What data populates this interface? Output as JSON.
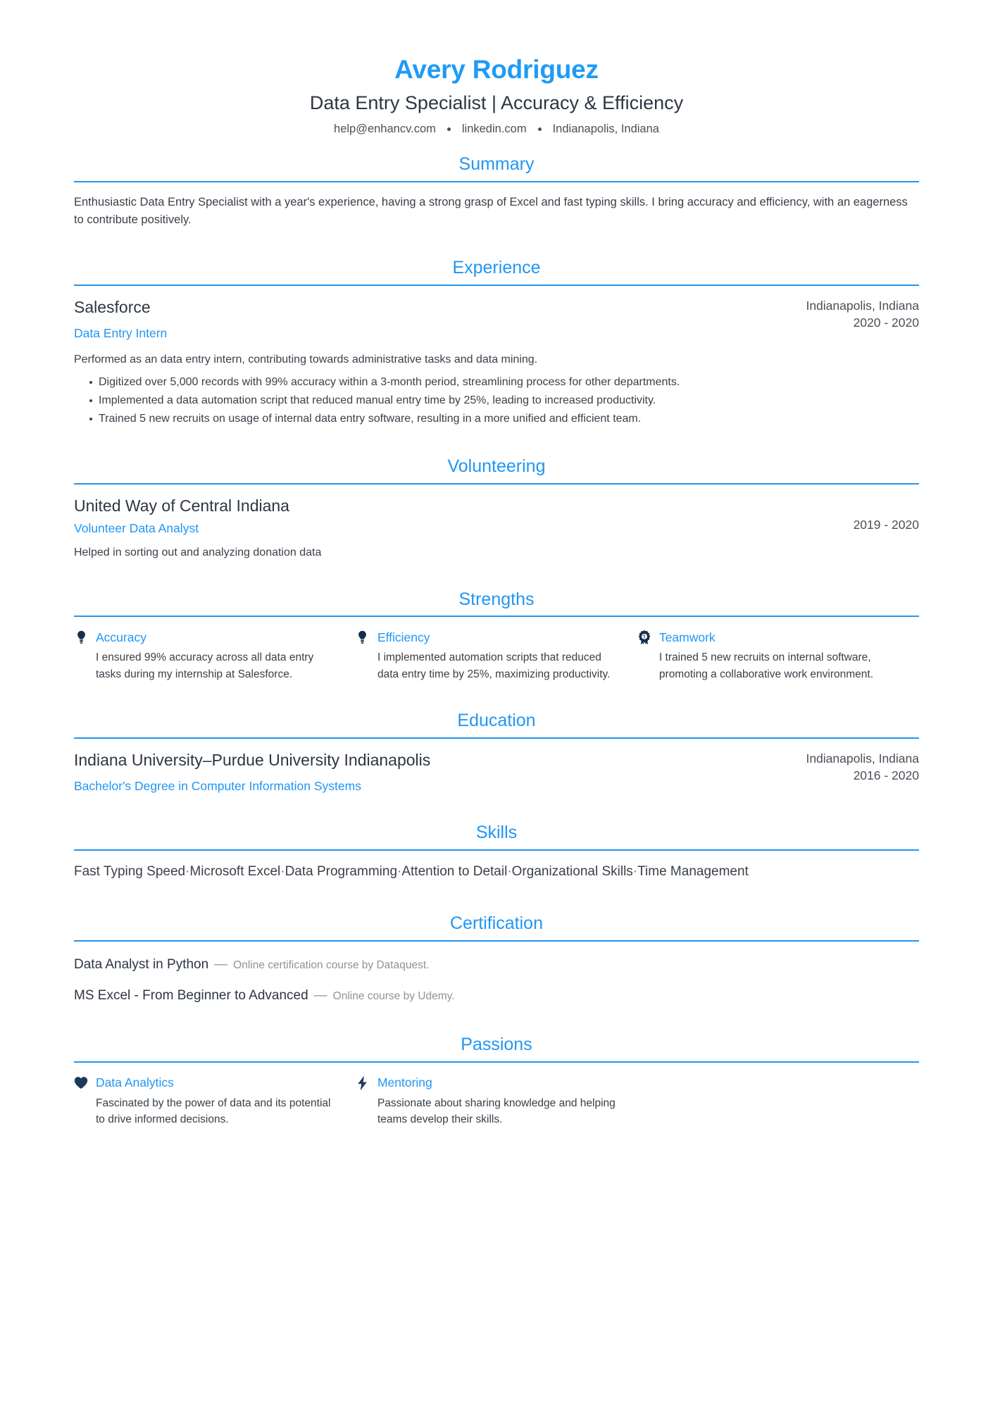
{
  "header": {
    "name": "Avery Rodriguez",
    "title": "Data Entry Specialist | Accuracy & Efficiency",
    "contacts": [
      "help@enhancv.com",
      "linkedin.com",
      "Indianapolis, Indiana"
    ]
  },
  "accent_color": "#2196f3",
  "sections": {
    "summary": {
      "title": "Summary",
      "text": "Enthusiastic Data Entry Specialist with a year's experience, having a strong grasp of Excel and fast typing skills. I bring accuracy and efficiency, with an eagerness to contribute positively."
    },
    "experience": {
      "title": "Experience",
      "entries": [
        {
          "org": "Salesforce",
          "role": "Data Entry Intern",
          "location": "Indianapolis, Indiana",
          "dates": "2020 - 2020",
          "desc": "Performed as an data entry intern, contributing towards administrative tasks and data mining.",
          "bullets": [
            "Digitized over 5,000 records with 99% accuracy within a 3-month period, streamlining process for other departments.",
            "Implemented a data automation script that reduced manual entry time by 25%, leading to increased productivity.",
            "Trained 5 new recruits on usage of internal data entry software, resulting in a more unified and efficient team."
          ]
        }
      ]
    },
    "volunteering": {
      "title": "Volunteering",
      "entries": [
        {
          "org": "United Way of Central Indiana",
          "role": "Volunteer Data Analyst",
          "dates": "2019 - 2020",
          "desc": "Helped in sorting out and analyzing donation data"
        }
      ]
    },
    "strengths": {
      "title": "Strengths",
      "items": [
        {
          "icon": "lightbulb-icon",
          "title": "Accuracy",
          "text": "I ensured 99% accuracy across all data entry tasks during my internship at Salesforce."
        },
        {
          "icon": "lightbulb-icon",
          "title": "Efficiency",
          "text": "I implemented automation scripts that reduced data entry time by 25%, maximizing productivity."
        },
        {
          "icon": "award-ribbon-icon",
          "title": "Teamwork",
          "text": "I trained 5 new recruits on internal software, promoting a collaborative work environment."
        }
      ]
    },
    "education": {
      "title": "Education",
      "entries": [
        {
          "org": "Indiana University–Purdue University Indianapolis",
          "role": "Bachelor's Degree in Computer Information Systems",
          "location": "Indianapolis, Indiana",
          "dates": "2016 - 2020"
        }
      ]
    },
    "skills": {
      "title": "Skills",
      "items": [
        "Fast Typing Speed",
        "Microsoft Excel",
        "Data Programming",
        "Attention to Detail",
        "Organizational Skills",
        "Time Management"
      ],
      "separator": "·"
    },
    "certification": {
      "title": "Certification",
      "dash": "—",
      "items": [
        {
          "name": "Data Analyst in Python",
          "desc": "Online certification course by Dataquest."
        },
        {
          "name": "MS Excel - From Beginner to Advanced",
          "desc": "Online course by Udemy."
        }
      ]
    },
    "passions": {
      "title": "Passions",
      "items": [
        {
          "icon": "heart-icon",
          "title": "Data Analytics",
          "text": "Fascinated by the power of data and its potential to drive informed decisions."
        },
        {
          "icon": "lightning-bolt-icon",
          "title": "Mentoring",
          "text": "Passionate about sharing knowledge and helping teams develop their skills."
        }
      ]
    }
  }
}
